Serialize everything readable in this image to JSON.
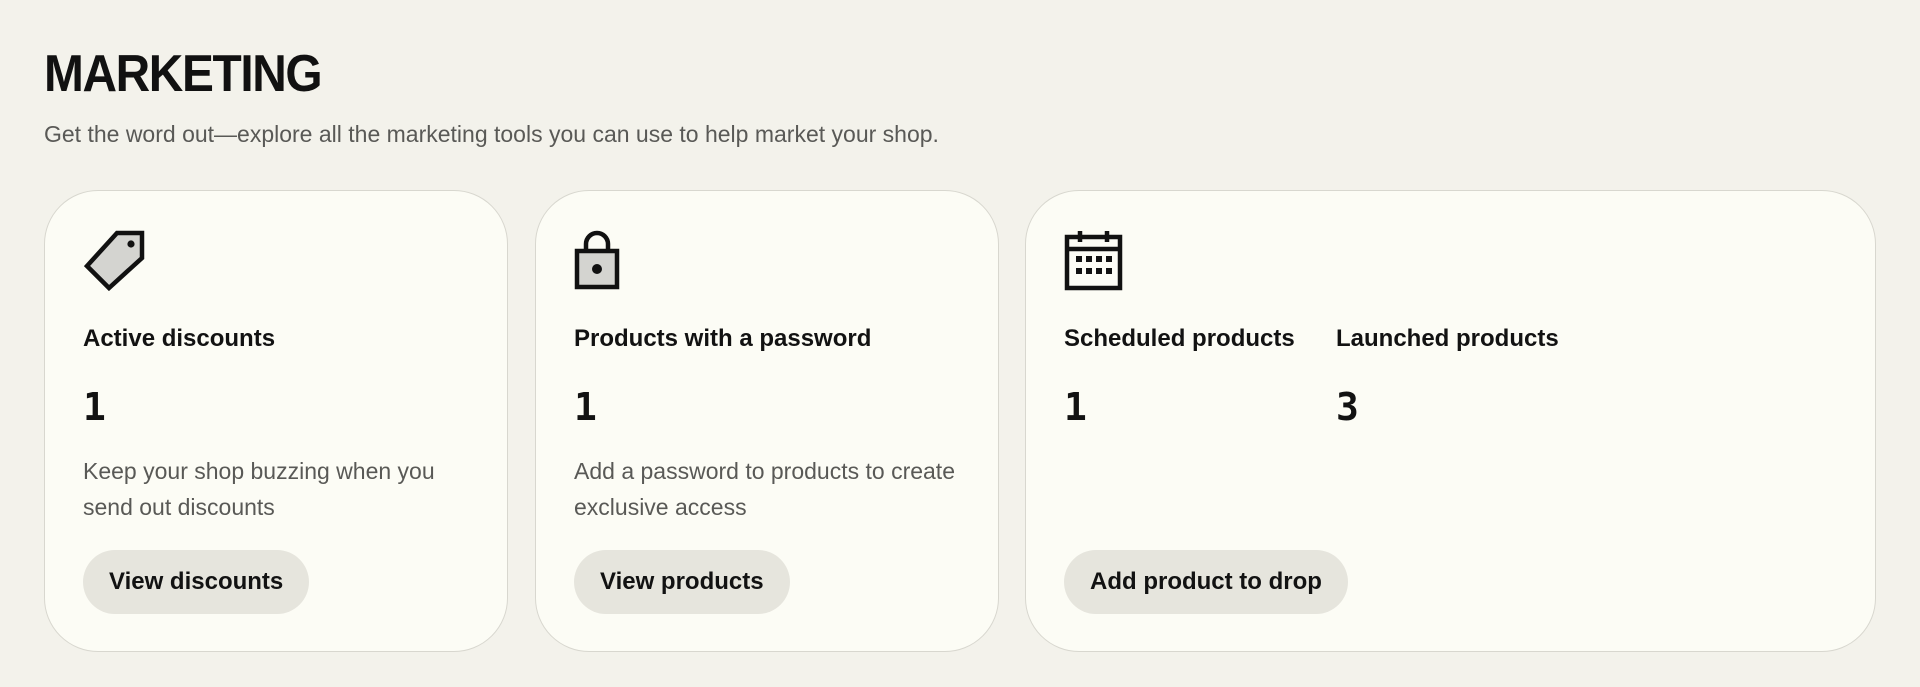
{
  "page": {
    "title": "MARKETING",
    "subtitle": "Get the word out—explore all the marketing tools you can use to help market your shop."
  },
  "cards": [
    {
      "icon": "tag-icon",
      "stats": [
        {
          "label": "Active discounts",
          "value": "1"
        }
      ],
      "description": "Keep your shop buzzing when you send out discounts",
      "button_label": "View discounts"
    },
    {
      "icon": "lock-icon",
      "stats": [
        {
          "label": "Products with a password",
          "value": "1"
        }
      ],
      "description": "Add a password to products to create exclusive access",
      "button_label": "View products"
    },
    {
      "icon": "calendar-icon",
      "stats": [
        {
          "label": "Scheduled products",
          "value": "1"
        },
        {
          "label": "Launched products",
          "value": "3"
        }
      ],
      "description": "",
      "button_label": "Add product to drop"
    }
  ],
  "colors": {
    "background": "#f3f2eb",
    "card_background": "#fcfcf5",
    "card_border": "#d8d7cf",
    "button_background": "#e6e5dd",
    "text_primary": "#121212",
    "text_secondary": "#595956",
    "icon_fill": "#d4d4d0"
  }
}
